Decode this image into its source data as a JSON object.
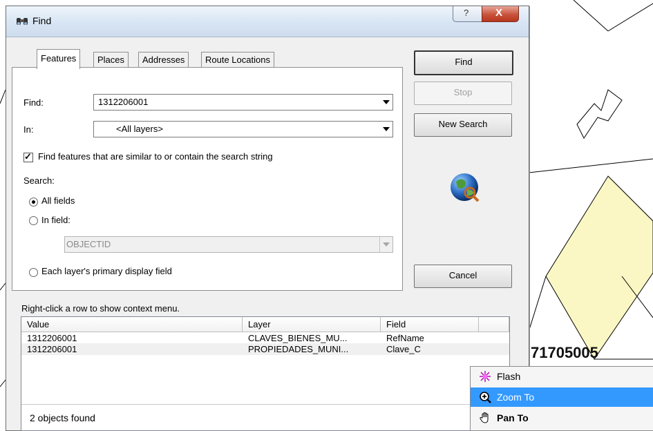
{
  "map": {
    "parcel_label": "71705005"
  },
  "dialog": {
    "title": "Find",
    "help_glyph": "?",
    "close_glyph": "X",
    "tabs": [
      {
        "label": "Features",
        "active": true
      },
      {
        "label": "Places"
      },
      {
        "label": "Addresses"
      },
      {
        "label": "Route Locations"
      }
    ],
    "find_label": "Find:",
    "find_value": "1312206001",
    "in_label": "In:",
    "in_value": "<All layers>",
    "similar_checkbox_label": "Find features that are similar to or contain the search string",
    "similar_checked": true,
    "search_label": "Search:",
    "radio_all_fields": "All fields",
    "radio_in_field": "In field:",
    "field_value": "OBJECTID",
    "radio_primary_field": "Each layer's primary display field",
    "selected_radio": "All fields",
    "buttons": {
      "find": "Find",
      "stop": "Stop",
      "new_search": "New Search",
      "cancel": "Cancel"
    },
    "hint": "Right-click a row to show context menu.",
    "columns": [
      "Value",
      "Layer",
      "Field"
    ],
    "rows": [
      {
        "value": "1312206001",
        "layer": "CLAVES_BIENES_MU...",
        "field": "RefName"
      },
      {
        "value": "1312206001",
        "layer": "PROPIEDADES_MUNI...",
        "field": "Clave_C"
      }
    ],
    "status": "2 objects found"
  },
  "context_menu": {
    "items": [
      {
        "label": "Flash",
        "icon": "flash-icon"
      },
      {
        "label": "Zoom To",
        "icon": "zoom-in-icon",
        "highlighted": true
      },
      {
        "label": "Pan To",
        "icon": "pan-hand-icon",
        "bold": true
      }
    ]
  },
  "colors": {
    "highlight": "#3399ff",
    "parcel_fill": "#fbf7c4"
  }
}
